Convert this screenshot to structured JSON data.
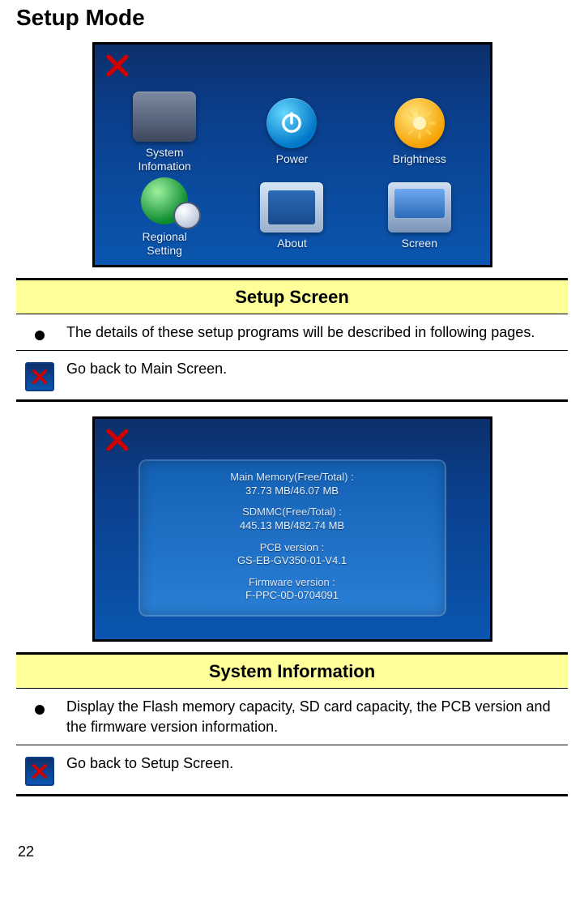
{
  "title": "Setup Mode",
  "setup_screen": {
    "icons": [
      {
        "label": "System\nInfomation"
      },
      {
        "label": "Power"
      },
      {
        "label": "Brightness"
      },
      {
        "label": "Regional\nSetting"
      },
      {
        "label": "About"
      },
      {
        "label": "Screen"
      }
    ]
  },
  "sysinfo_screen": {
    "main_memory_label": "Main Memory(Free/Total) :",
    "main_memory_value": "37.73 MB/46.07 MB",
    "sdmmc_label": "SDMMC(Free/Total) :",
    "sdmmc_value": "445.13 MB/482.74 MB",
    "pcb_label": "PCB version :",
    "pcb_value": "GS-EB-GV350-01-V4.1",
    "fw_label": "Firmware version :",
    "fw_value": "F-PPC-0D-0704091"
  },
  "sections": [
    {
      "header": "Setup Screen",
      "rows": [
        {
          "icon": "bullet",
          "text": "The details of these setup programs will be described in following pages."
        },
        {
          "icon": "close",
          "text": "Go back to Main Screen."
        }
      ]
    },
    {
      "header": "System Information",
      "rows": [
        {
          "icon": "bullet",
          "text": "Display the Flash memory capacity, SD card capacity, the PCB version and the firmware version information."
        },
        {
          "icon": "close",
          "text": "Go back to Setup Screen."
        }
      ]
    }
  ],
  "page_number": "22"
}
